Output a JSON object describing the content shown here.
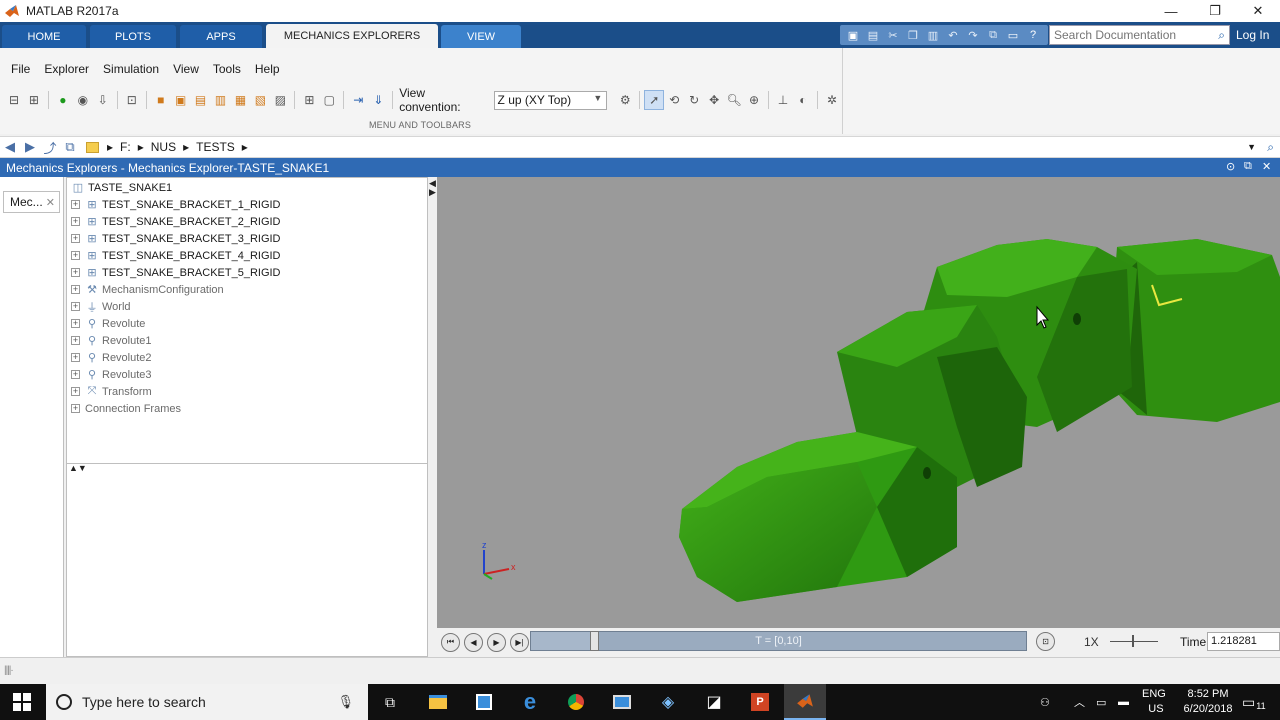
{
  "window": {
    "title": "MATLAB R2017a",
    "minimize": "—",
    "restore": "❐",
    "close": "✕"
  },
  "ribbon_tabs": [
    "HOME",
    "PLOTS",
    "APPS",
    "MECHANICS EXPLORERS",
    "VIEW"
  ],
  "search": {
    "placeholder": "Search Documentation"
  },
  "login": "Log In",
  "menu": [
    "File",
    "Explorer",
    "Simulation",
    "View",
    "Tools",
    "Help"
  ],
  "toolbar": {
    "view_convention_label": "View convention:",
    "view_convention_value": "Z up (XY Top)"
  },
  "ribbon_caption": "MENU AND TOOLBARS",
  "address": {
    "crumbs": [
      "F:",
      "NUS",
      "TESTS"
    ]
  },
  "panel_title": "Mechanics Explorers - Mechanics Explorer-TASTE_SNAKE1",
  "side_tab": "Mec...",
  "tree": {
    "root": "TASTE_SNAKE1",
    "items": [
      {
        "label": "TEST_SNAKE_BRACKET_1_RIGID",
        "icon": "subsystem-icon",
        "dim": false
      },
      {
        "label": "TEST_SNAKE_BRACKET_2_RIGID",
        "icon": "subsystem-icon",
        "dim": false
      },
      {
        "label": "TEST_SNAKE_BRACKET_3_RIGID",
        "icon": "subsystem-icon",
        "dim": false
      },
      {
        "label": "TEST_SNAKE_BRACKET_4_RIGID",
        "icon": "subsystem-icon",
        "dim": false
      },
      {
        "label": "TEST_SNAKE_BRACKET_5_RIGID",
        "icon": "subsystem-icon",
        "dim": false
      },
      {
        "label": "MechanismConfiguration",
        "icon": "wrench-icon",
        "dim": true
      },
      {
        "label": "World",
        "icon": "world-icon",
        "dim": true
      },
      {
        "label": "Revolute",
        "icon": "joint-icon",
        "dim": true
      },
      {
        "label": "Revolute1",
        "icon": "joint-icon",
        "dim": true
      },
      {
        "label": "Revolute2",
        "icon": "joint-icon",
        "dim": true
      },
      {
        "label": "Revolute3",
        "icon": "joint-icon",
        "dim": true
      },
      {
        "label": "Transform",
        "icon": "transform-icon",
        "dim": true
      },
      {
        "label": "Connection Frames",
        "icon": "",
        "dim": true
      }
    ]
  },
  "viewport": {
    "axis_x": "x",
    "axis_z": "z",
    "model_color": "#2f9a12",
    "background": "#9a9a9a"
  },
  "playback": {
    "time_range": "T = [0,10]",
    "speed": "1X",
    "time_label": "Time",
    "time_value": "1.218281",
    "progress": 0.12
  },
  "taskbar": {
    "search_placeholder": "Type here to search",
    "lang": "ENG",
    "region": "US",
    "time": "8:52 PM",
    "date": "6/20/2018",
    "notifications": "11"
  }
}
